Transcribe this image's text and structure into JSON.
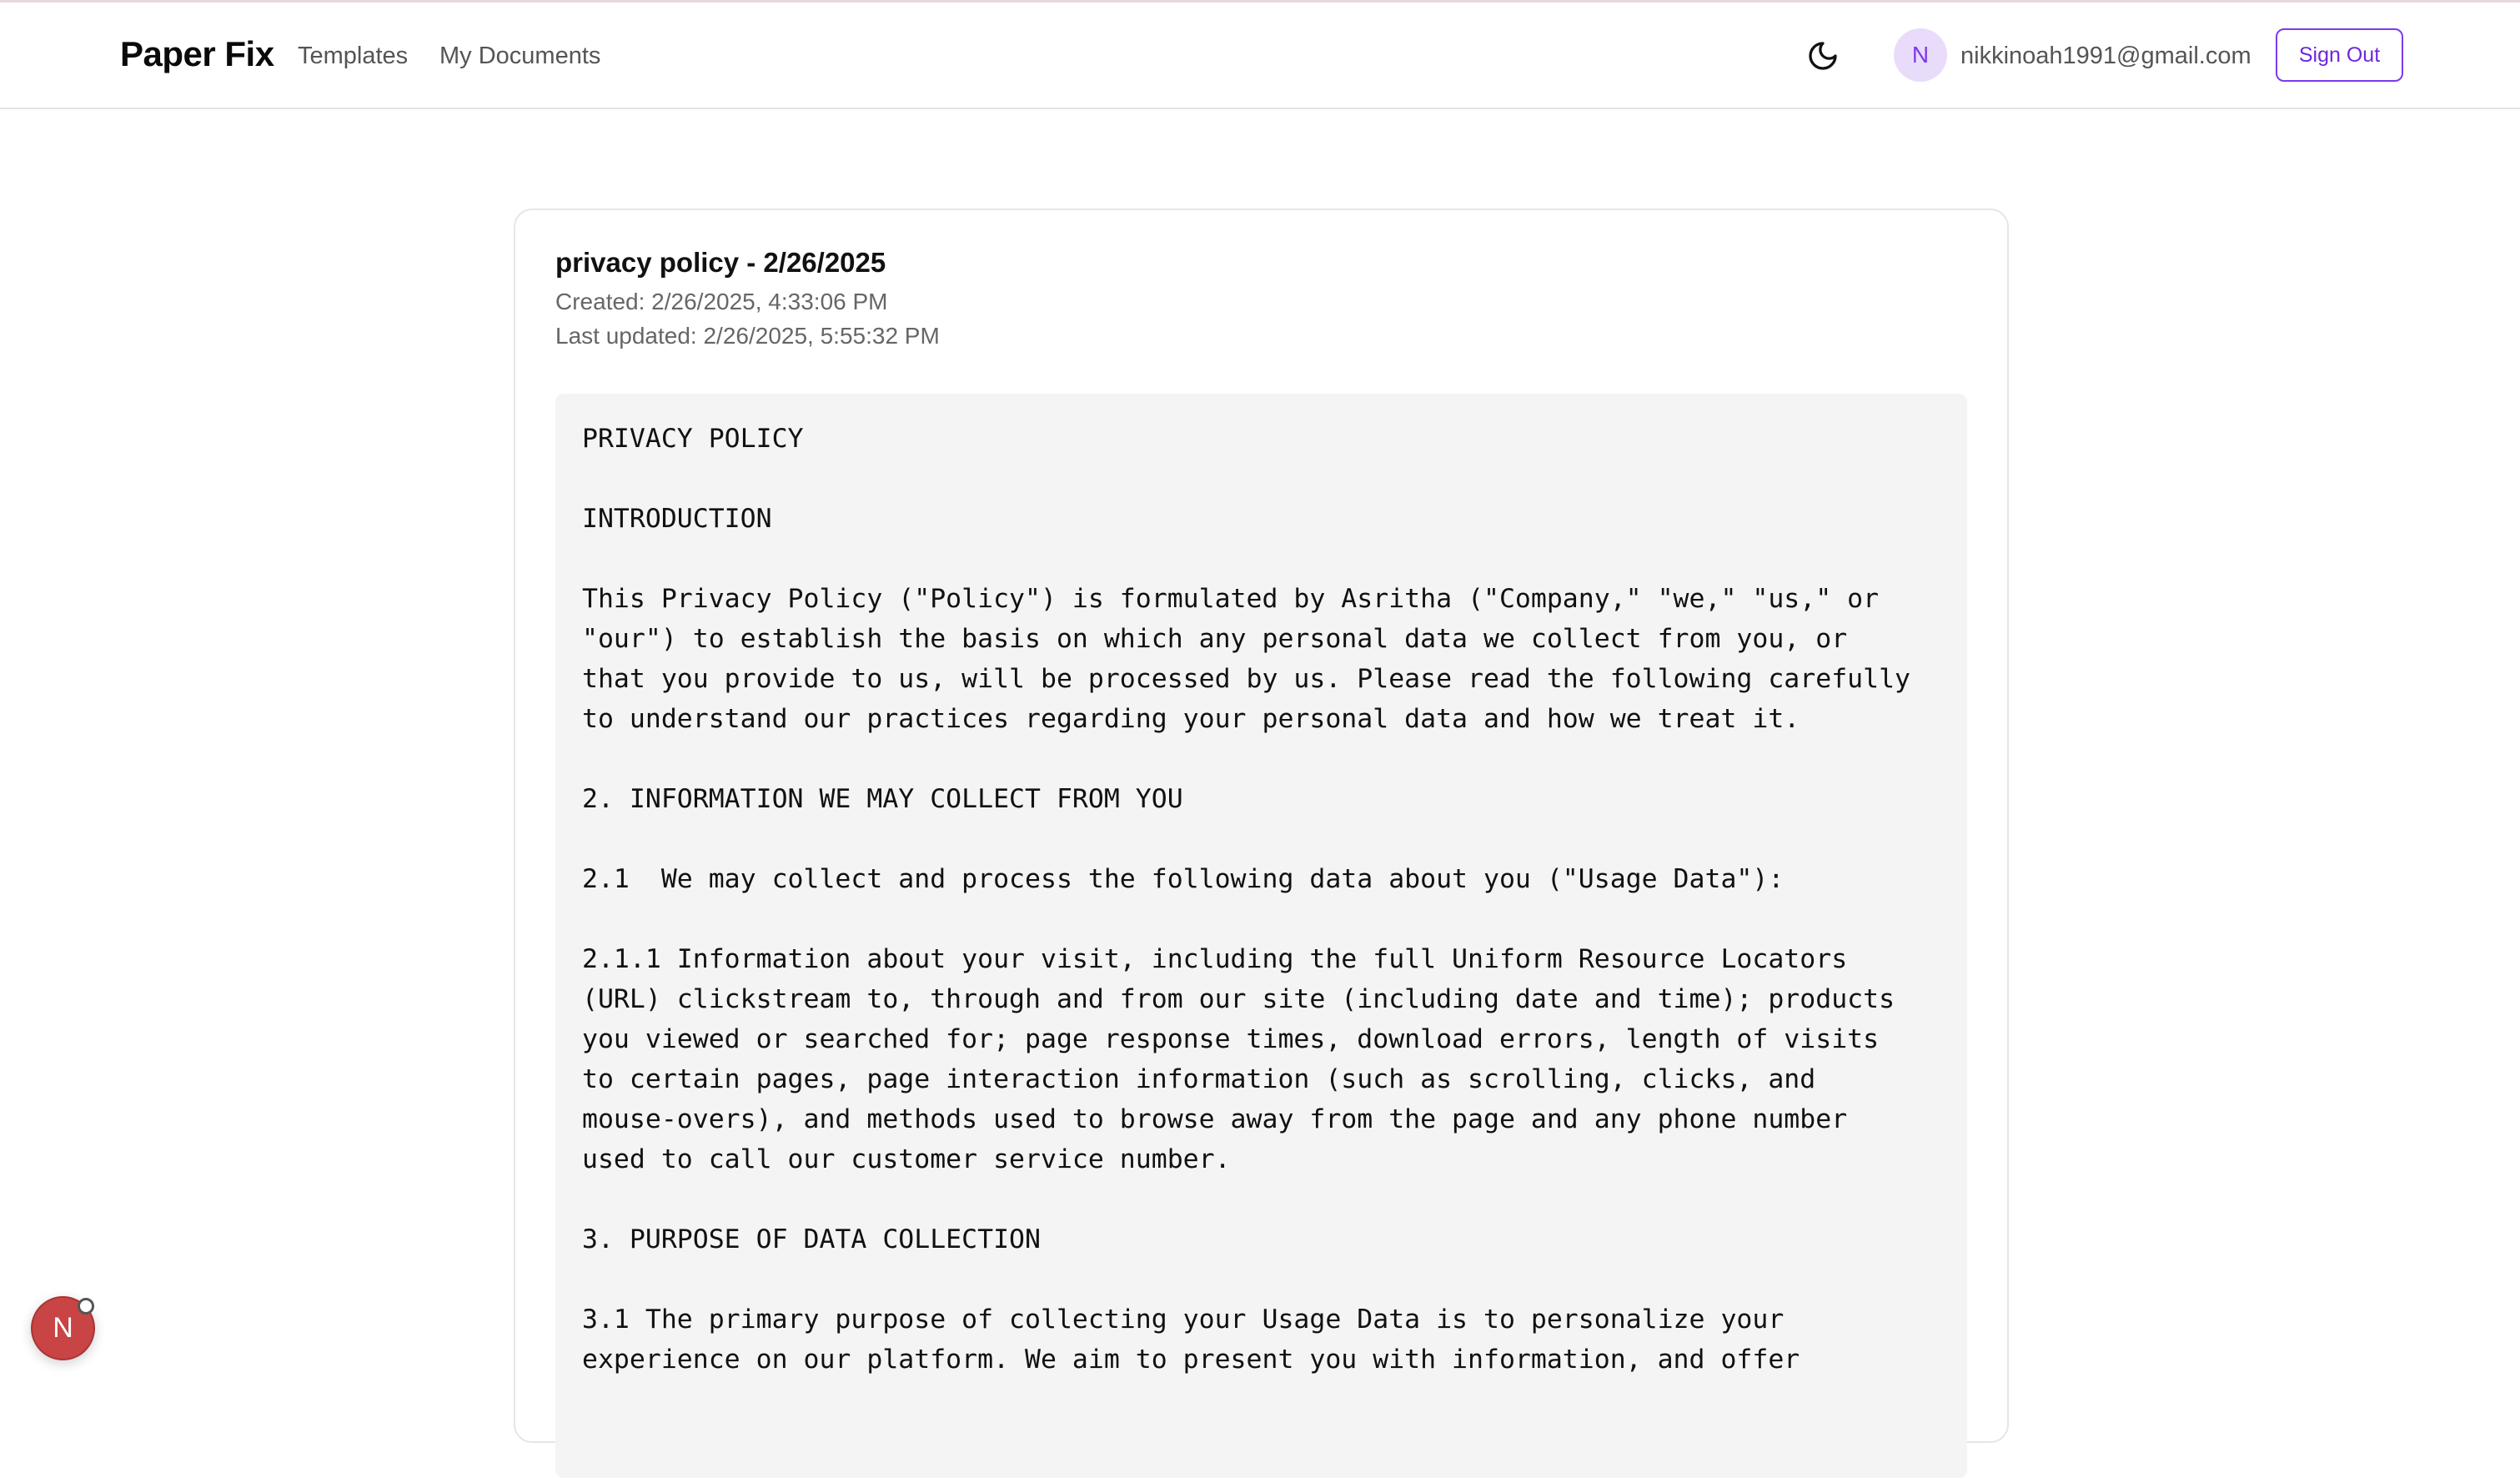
{
  "header": {
    "brand": "Paper Fix",
    "nav": [
      "Templates",
      "My Documents"
    ],
    "avatar_initial": "N",
    "email": "nikkinoah1991@gmail.com",
    "signout_label": "Sign Out",
    "theme_icon": "moon-icon"
  },
  "document": {
    "title": "privacy policy - 2/26/2025",
    "created": "Created: 2/26/2025, 4:33:06 PM",
    "updated": "Last updated: 2/26/2025, 5:55:32 PM",
    "lines": [
      "PRIVACY POLICY",
      "",
      "INTRODUCTION",
      "",
      "This Privacy Policy (\"Policy\") is formulated by Asritha (\"Company,\" \"we,\" \"us,\" or",
      "\"our\") to establish the basis on which any personal data we collect from you, or",
      "that you provide to us, will be processed by us. Please read the following carefully",
      "to understand our practices regarding your personal data and how we treat it.",
      "",
      "2. INFORMATION WE MAY COLLECT FROM YOU",
      "",
      "2.1  We may collect and process the following data about you (\"Usage Data\"):",
      "",
      "2.1.1 Information about your visit, including the full Uniform Resource Locators",
      "(URL) clickstream to, through and from our site (including date and time); products",
      "you viewed or searched for; page response times, download errors, length of visits",
      "to certain pages, page interaction information (such as scrolling, clicks, and",
      "mouse-overs), and methods used to browse away from the page and any phone number",
      "used to call our customer service number.",
      "",
      "3. PURPOSE OF DATA COLLECTION",
      "",
      "3.1 The primary purpose of collecting your Usage Data is to personalize your",
      "experience on our platform. We aim to present you with information, and offer"
    ]
  },
  "dev_badge": {
    "letter": "N"
  }
}
